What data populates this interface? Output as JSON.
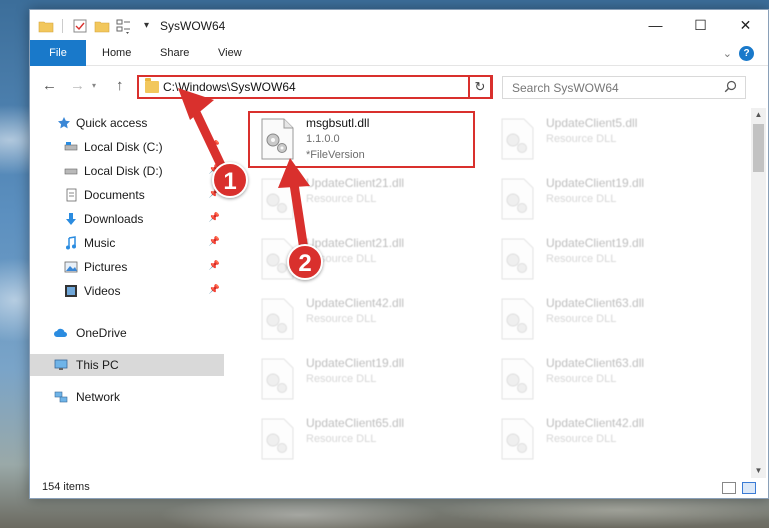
{
  "window": {
    "title": "SysWOW64",
    "controls": {
      "minimize": "—",
      "maximize": "☐",
      "close": "✕"
    }
  },
  "ribbon": {
    "tabs": [
      {
        "label": "File",
        "active": true
      },
      {
        "label": "Home"
      },
      {
        "label": "Share"
      },
      {
        "label": "View"
      }
    ],
    "help": "?"
  },
  "address": {
    "path": "C:\\Windows\\SysWOW64",
    "refresh_glyph": "↻"
  },
  "search": {
    "placeholder": "Search SysWOW64",
    "icon": "search-icon"
  },
  "nav_pane": {
    "items": [
      {
        "label": "Quick access",
        "icon": "star-icon"
      },
      {
        "label": "Local Disk (C:)",
        "icon": "drive-icon",
        "pinned": true
      },
      {
        "label": "Local Disk (D:)",
        "icon": "drive-icon",
        "pinned": true
      },
      {
        "label": "Documents",
        "icon": "documents-icon",
        "pinned": true
      },
      {
        "label": "Downloads",
        "icon": "download-icon",
        "pinned": true
      },
      {
        "label": "Music",
        "icon": "music-icon",
        "pinned": true
      },
      {
        "label": "Pictures",
        "icon": "pictures-icon",
        "pinned": true
      },
      {
        "label": "Videos",
        "icon": "videos-icon",
        "pinned": true
      },
      {
        "label": "OneDrive",
        "icon": "cloud-icon"
      },
      {
        "label": "This PC",
        "icon": "computer-icon",
        "selected": true
      },
      {
        "label": "Network",
        "icon": "network-icon"
      }
    ]
  },
  "files": [
    {
      "name": "msgbsutl.dll",
      "line2": "1.1.0.0",
      "line3": "*FileVersion",
      "highlighted": true
    },
    {
      "name": "UpdateClient5.dll",
      "line2": "Resource DLL"
    },
    {
      "name": "UpdateClient21.dll",
      "line2": "Resource DLL"
    },
    {
      "name": "UpdateClient19.dll",
      "line2": "Resource DLL"
    },
    {
      "name": "UpdateClient21.dll",
      "line2": "Resource DLL"
    },
    {
      "name": "UpdateClient19.dll",
      "line2": "Resource DLL"
    },
    {
      "name": "UpdateClient42.dll",
      "line2": "Resource DLL"
    },
    {
      "name": "UpdateClient63.dll",
      "line2": "Resource DLL"
    },
    {
      "name": "UpdateClient19.dll",
      "line2": "Resource DLL"
    },
    {
      "name": "UpdateClient63.dll",
      "line2": "Resource DLL"
    },
    {
      "name": "UpdateClient65.dll",
      "line2": "Resource DLL"
    },
    {
      "name": "UpdateClient42.dll",
      "line2": "Resource DLL"
    }
  ],
  "status": {
    "item_count": "154 items"
  },
  "callouts": [
    "1",
    "2"
  ],
  "colors": {
    "accent": "#1979ca",
    "highlight": "#d9302d"
  }
}
